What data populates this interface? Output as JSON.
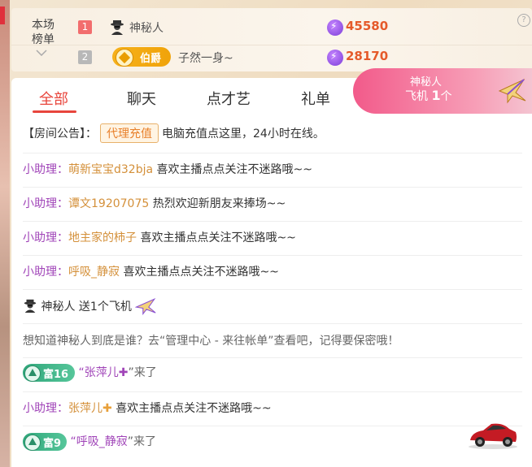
{
  "rank_panel": {
    "title": "本场\n榜单",
    "title_line1": "本场",
    "title_line2": "榜单",
    "expand_icon": "chevron-down-icon",
    "help_icon": "?",
    "rows": [
      {
        "rank": "1",
        "name": "神秘人",
        "score": "45580"
      },
      {
        "rank": "2",
        "badge": "伯爵",
        "name": "子然一身~",
        "score": "28170"
      }
    ]
  },
  "tabs": [
    {
      "label": "全部",
      "active": true
    },
    {
      "label": "聊天"
    },
    {
      "label": "点才艺"
    },
    {
      "label": "礼单"
    }
  ],
  "gift_pill": {
    "sender": "神秘人",
    "gift": "飞机",
    "count": "1",
    "unit": "个"
  },
  "announcement": {
    "prefix": "【房间公告】：",
    "tag": "代理充值",
    "text": "电脑充值点这里，24小时在线。"
  },
  "feed": {
    "assistant_label": "小助理：",
    "items": [
      {
        "nick": "萌新宝宝d32bja",
        "text": "喜欢主播点点关注不迷路哦~~"
      },
      {
        "nick": "谭文19207075",
        "text": "热烈欢迎新朋友来捧场~~"
      },
      {
        "nick": "地主家的柿子",
        "text": "喜欢主播点点关注不迷路哦~~"
      },
      {
        "nick": "呼吸_静寂",
        "text": "喜欢主播点点关注不迷路哦~~"
      }
    ],
    "gift_line": {
      "sender": "神秘人",
      "text": "送1个飞机"
    },
    "hint": "想知道神秘人到底是谁？去“管理中心 - 来往帐单”查看吧，记得要保密哦！",
    "arrival1": {
      "level": "富16",
      "name": "“张萍儿",
      "plus": "✚",
      "suffix": "”来了"
    },
    "assistant2": {
      "nick": "张萍儿",
      "plus": "✚",
      "text": "喜欢主播点点关注不迷路哦~~"
    },
    "arrival2": {
      "level": "富9",
      "name": "“呼吸_静寂",
      "suffix": "”来了"
    }
  },
  "colors": {
    "accent": "#e8453c",
    "assistant": "#a044b8",
    "nick": "#d4903a",
    "score": "#e55a2a"
  }
}
